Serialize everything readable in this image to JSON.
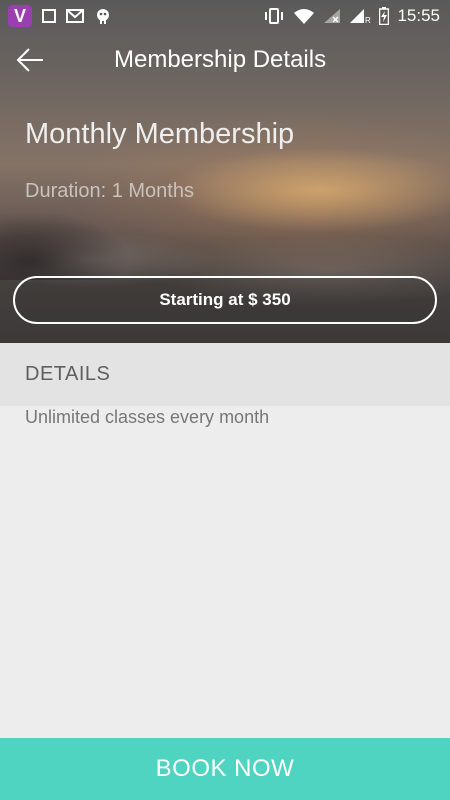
{
  "statusbar": {
    "app_logo_letter": "V",
    "time": "15:55",
    "roaming_indicator": "R"
  },
  "toolbar": {
    "title": "Membership Details",
    "back_icon": "back-arrow-icon"
  },
  "membership": {
    "name": "Monthly Membership",
    "duration": "Duration: 1 Months",
    "price_label": "Starting at $ 350"
  },
  "details": {
    "header": "DETAILS",
    "description": "Unlimited classes every month"
  },
  "actions": {
    "book_label": "BOOK NOW"
  },
  "colors": {
    "accent": "#4fd4c2",
    "app_logo": "#9b3fb0",
    "details_bg": "#e3e3e3",
    "page_bg": "#ededed"
  }
}
